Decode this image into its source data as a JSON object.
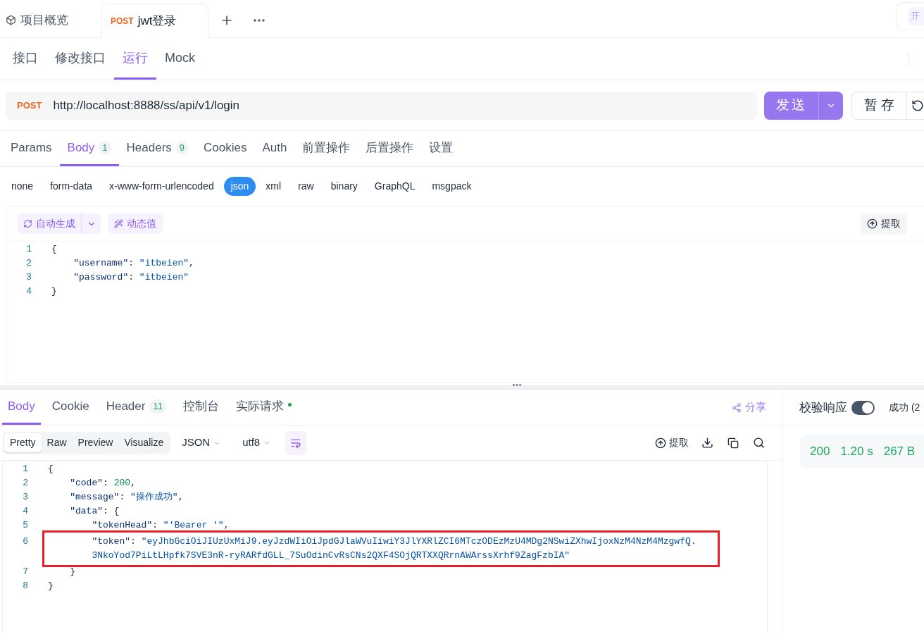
{
  "doc_tabs": [
    {
      "kind": "overview",
      "label": "项目概览",
      "selected": false
    },
    {
      "kind": "request",
      "method": "POST",
      "label": "jwt登录",
      "selected": true
    }
  ],
  "top_right_button": "开",
  "sub_tabs": [
    {
      "label": "接口",
      "selected": false
    },
    {
      "label": "修改接口",
      "selected": false
    },
    {
      "label": "运行",
      "selected": true
    },
    {
      "label": "Mock",
      "selected": false
    }
  ],
  "url_bar": {
    "method": "POST",
    "url": "http://localhost:8888/ss/api/v1/login"
  },
  "send_button": "发送",
  "save_button": "暂 存",
  "request_tabs": [
    {
      "label": "Params",
      "selected": false
    },
    {
      "label": "Body",
      "count": "1",
      "selected": true
    },
    {
      "label": "Headers",
      "count": "9",
      "selected": false
    },
    {
      "label": "Cookies",
      "selected": false
    },
    {
      "label": "Auth",
      "selected": false
    },
    {
      "label": "前置操作",
      "selected": false
    },
    {
      "label": "后置操作",
      "selected": false
    },
    {
      "label": "设置",
      "selected": false
    }
  ],
  "body_types": [
    {
      "label": "none",
      "selected": false
    },
    {
      "label": "form-data",
      "selected": false
    },
    {
      "label": "x-www-form-urlencoded",
      "selected": false
    },
    {
      "label": "json",
      "selected": true
    },
    {
      "label": "xml",
      "selected": false
    },
    {
      "label": "raw",
      "selected": false
    },
    {
      "label": "binary",
      "selected": false
    },
    {
      "label": "GraphQL",
      "selected": false
    },
    {
      "label": "msgpack",
      "selected": false
    }
  ],
  "editor_toolbar": {
    "auto_generate": "自动生成",
    "dynamic_value": "动态值",
    "extract": "提取"
  },
  "request_code": [
    {
      "number": "1",
      "tokens": [
        {
          "kind": "punct",
          "text": "{"
        }
      ]
    },
    {
      "number": "2",
      "tokens": [
        {
          "kind": "key",
          "text": "    \"username\""
        },
        {
          "kind": "punct",
          "text": ": "
        },
        {
          "kind": "string",
          "text": "\"itbeien\""
        },
        {
          "kind": "punct",
          "text": ","
        }
      ]
    },
    {
      "number": "3",
      "tokens": [
        {
          "kind": "key",
          "text": "    \"password\""
        },
        {
          "kind": "punct",
          "text": ": "
        },
        {
          "kind": "string",
          "text": "\"itbeien\""
        }
      ]
    },
    {
      "number": "4",
      "tokens": [
        {
          "kind": "punct",
          "text": "}"
        }
      ]
    }
  ],
  "response_tabs": [
    {
      "label": "Body",
      "selected": true
    },
    {
      "label": "Cookie",
      "selected": false
    },
    {
      "label": "Header",
      "count": "11",
      "selected": false
    },
    {
      "label": "控制台",
      "selected": false
    },
    {
      "label": "实际请求",
      "dot": true,
      "selected": false
    }
  ],
  "share": "分享",
  "view_modes": [
    {
      "label": "Pretty",
      "selected": true
    },
    {
      "label": "Raw",
      "selected": false
    },
    {
      "label": "Preview",
      "selected": false
    },
    {
      "label": "Visualize",
      "selected": false
    }
  ],
  "format_select": "JSON",
  "encoding_select": "utf8",
  "response_extract": "提取",
  "response_code": [
    {
      "number": "1",
      "tokens": [
        {
          "kind": "punct",
          "text": "{"
        }
      ]
    },
    {
      "number": "2",
      "tokens": [
        {
          "kind": "key",
          "text": "    \"code\""
        },
        {
          "kind": "punct",
          "text": ": "
        },
        {
          "kind": "number",
          "text": "200"
        },
        {
          "kind": "punct",
          "text": ","
        }
      ]
    },
    {
      "number": "3",
      "tokens": [
        {
          "kind": "key",
          "text": "    \"message\""
        },
        {
          "kind": "punct",
          "text": ": "
        },
        {
          "kind": "string",
          "text": "\"操作成功\""
        },
        {
          "kind": "punct",
          "text": ","
        }
      ]
    },
    {
      "number": "4",
      "tokens": [
        {
          "kind": "key",
          "text": "    \"data\""
        },
        {
          "kind": "punct",
          "text": ": {"
        }
      ]
    },
    {
      "number": "5",
      "tokens": [
        {
          "kind": "key",
          "text": "        \"tokenHead\""
        },
        {
          "kind": "punct",
          "text": ": "
        },
        {
          "kind": "string",
          "text": "\"'Bearer '\""
        },
        {
          "kind": "punct",
          "text": ","
        }
      ]
    },
    {
      "number": "6",
      "highlighted": true,
      "tokens": [
        {
          "kind": "key",
          "text": "        \"token\""
        },
        {
          "kind": "punct",
          "text": ": "
        },
        {
          "kind": "string",
          "text": "\"eyJhbGciOiJIUzUxMiJ9.eyJzdWIiOiJpdGJlaWVuIiwiY3JlYXRlZCI6MTczODEzMzU4MDg2NSwiZXhwIjoxNzM4NzM4MzgwfQ."
        }
      ]
    },
    {
      "highlighted": true,
      "tokens": [
        {
          "kind": "string",
          "text": "        3NkoYod7PiLtLHpfk7SVE3nR-ryRARfdGLL_7SuOdinCvRsCNs2QXF4SOjQRTXXQRrnAWArssXrhf9ZagFzbIA\""
        }
      ]
    },
    {
      "number": "7",
      "tokens": [
        {
          "kind": "punct",
          "text": "    }"
        }
      ]
    },
    {
      "number": "8",
      "tokens": [
        {
          "kind": "punct",
          "text": "}"
        }
      ]
    }
  ],
  "validate": {
    "label": "校验响应",
    "on": true,
    "result": "成功 (2"
  },
  "stats": {
    "status": "200",
    "time": "1.20 s",
    "size": "267 B"
  }
}
